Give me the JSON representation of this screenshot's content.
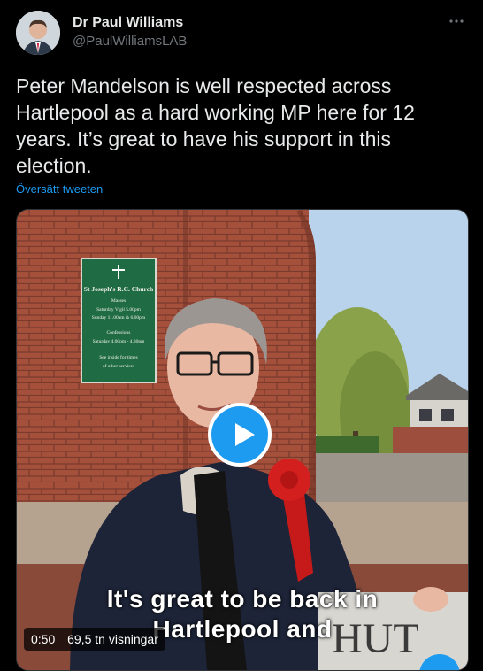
{
  "author": {
    "display_name": "Dr Paul Williams",
    "handle": "@PaulWilliamsLAB"
  },
  "tweet": {
    "text": "Peter Mandelson is well respected across Hartlepool as a hard working MP here for 12 years. It’s great to have his support in this election.",
    "translate_label": "Översätt tweeten"
  },
  "video": {
    "caption_line1": "It's great to be back in",
    "caption_line2": "Hartlepool and",
    "duration": "0:50",
    "views": "69,5 tn visningar",
    "sign_lines": [
      "St Joseph's R.C. Church",
      "Masses",
      "Saturday Vigil 5.00pm",
      "Sunday 11.00am & 6.00pm",
      "Confessions",
      "Saturday 4.00pm - 4.30pm",
      "See inside for times",
      "of other services"
    ],
    "bg_sign_text": "HUT"
  },
  "colors": {
    "accent": "#1d9bf0",
    "background": "#000000",
    "text": "#e7e9ea",
    "muted": "#71767b"
  },
  "icons": [
    "more-icon",
    "play-icon",
    "avatar"
  ]
}
